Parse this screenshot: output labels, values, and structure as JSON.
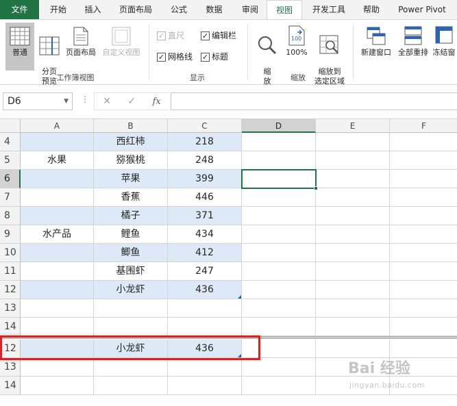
{
  "ribbon_tabs": [
    "文件",
    "开始",
    "插入",
    "页面布局",
    "公式",
    "数据",
    "审阅",
    "视图",
    "开发工具",
    "帮助",
    "Power Pivot"
  ],
  "active_tab": "视图",
  "groups": {
    "workbook_views": {
      "label": "工作簿视图",
      "normal": "普通",
      "page_break": "分页\n预览",
      "page_layout": "页面布局",
      "custom_views": "自定义视图"
    },
    "show": {
      "label": "显示",
      "ruler": "直尺",
      "formula_bar": "编辑栏",
      "gridlines": "网格线",
      "headings": "标题"
    },
    "zoom": {
      "label": "缩放",
      "zoom": "缩\n放",
      "zoom100": "100%",
      "zoom_selection": "缩放到\n选定区域"
    },
    "window": {
      "new_window": "新建窗口",
      "arrange_all": "全部重排",
      "freeze_panes": "冻结窗"
    }
  },
  "name_box": "D6",
  "formula_bar": {
    "cancel": "✕",
    "enter": "✓",
    "fx": "fx"
  },
  "columns": [
    "A",
    "B",
    "C",
    "D",
    "E",
    "F"
  ],
  "selected_column": "D",
  "upper_rows": [
    {
      "row": "4",
      "a": "",
      "b": "西红柿",
      "c": "218"
    },
    {
      "row": "5",
      "a": "水果",
      "b": "猕猴桃",
      "c": "248"
    },
    {
      "row": "6",
      "a": "",
      "b": "苹果",
      "c": "399"
    },
    {
      "row": "7",
      "a": "",
      "b": "香蕉",
      "c": "446"
    },
    {
      "row": "8",
      "a": "",
      "b": "橘子",
      "c": "371"
    },
    {
      "row": "9",
      "a": "水产品",
      "b": "鲤鱼",
      "c": "434"
    },
    {
      "row": "10",
      "a": "",
      "b": "鲫鱼",
      "c": "412"
    },
    {
      "row": "11",
      "a": "",
      "b": "基围虾",
      "c": "247"
    },
    {
      "row": "12",
      "a": "",
      "b": "小龙虾",
      "c": "436"
    },
    {
      "row": "13",
      "a": "",
      "b": "",
      "c": ""
    },
    {
      "row": "14",
      "a": "",
      "b": "",
      "c": ""
    }
  ],
  "lower_rows": [
    {
      "row": "12",
      "a": "",
      "b": "小龙虾",
      "c": "436"
    },
    {
      "row": "13",
      "a": "",
      "b": "",
      "c": ""
    },
    {
      "row": "14",
      "a": "",
      "b": "",
      "c": ""
    }
  ],
  "selected_row": "6",
  "watermark": {
    "main": "Bai 经验",
    "sub": "jingyan.baidu.com"
  },
  "colors": {
    "excel_green": "#217346",
    "band_blue": "#dde9f6",
    "highlight_red": "#e02020"
  }
}
